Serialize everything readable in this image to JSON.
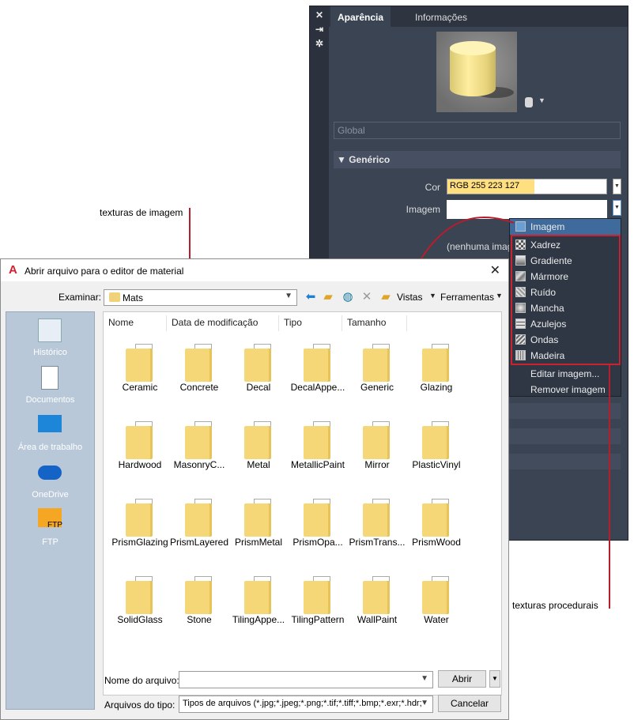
{
  "material_editor": {
    "tabs": [
      "Aparência",
      "Informações"
    ],
    "global_field": "Global",
    "section_header": "Genérico",
    "cor_label": "Cor",
    "cor_value": "RGB 255 223 127",
    "cor_swatch_color": "#ffdf7f",
    "imagem_label": "Imagem",
    "imagem_none": "(nenhuma imagem)"
  },
  "image_menu": {
    "items": [
      "Imagem",
      "Xadrez",
      "Gradiente",
      "Mármore",
      "Ruído",
      "Mancha",
      "Azulejos",
      "Ondas",
      "Madeira",
      "Editar imagem...",
      "Remover imagem"
    ],
    "selected": "Imagem"
  },
  "annotations": {
    "image_textures": "texturas de imagem",
    "procedural_textures": "texturas procedurais"
  },
  "file_dialog": {
    "title": "Abrir arquivo para o editor de material",
    "look_in_label": "Examinar:",
    "look_in_value": "Mats",
    "views_label": "Vistas",
    "tools_label": "Ferramentas",
    "places": [
      "Histórico",
      "Documentos",
      "Área de trabalho",
      "OneDrive",
      "FTP"
    ],
    "ftp_badge": "FTP",
    "columns": [
      "Nome",
      "Data de modificação",
      "Tipo",
      "Tamanho"
    ],
    "files": [
      "Ceramic",
      "Concrete",
      "Decal",
      "DecalAppe...",
      "Generic",
      "Glazing",
      "Hardwood",
      "MasonryC...",
      "Metal",
      "MetallicPaint",
      "Mirror",
      "PlasticVinyl",
      "PrismGlazing",
      "PrismLayered",
      "PrismMetal",
      "PrismOpa...",
      "PrismTrans...",
      "PrismWood",
      "SolidGlass",
      "Stone",
      "TilingAppe...",
      "TilingPattern",
      "WallPaint",
      "Water"
    ],
    "filename_label": "Nome do arquivo:",
    "filename_value": "",
    "filetype_label": "Arquivos do tipo:",
    "filetype_value": "Tipos de arquivos (*.jpg;*.jpeg;*.png;*.tif;*.tiff;*.bmp;*.exr;*.hdr;*.dds)",
    "open_button": "Abrir",
    "cancel_button": "Cancelar"
  },
  "colors": {
    "panel_bg": "#3b4453",
    "highlight_red": "#cc2230",
    "menu_selection": "#3e6a9c"
  }
}
